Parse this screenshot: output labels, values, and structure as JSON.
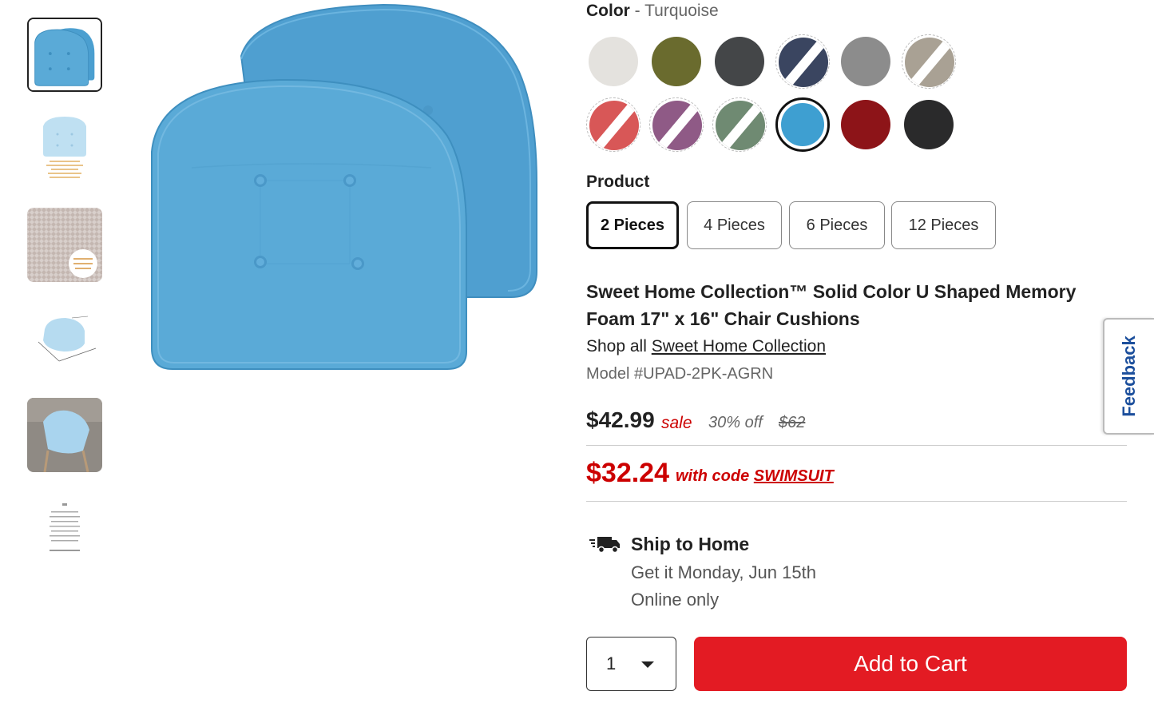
{
  "color_selector": {
    "label": "Color",
    "separator": " - ",
    "selected_value": "Turquoise",
    "swatches": [
      {
        "color": "#e4e2de",
        "available": true,
        "selected": false
      },
      {
        "color": "#6a6b2e",
        "available": true,
        "selected": false
      },
      {
        "color": "#444648",
        "available": true,
        "selected": false
      },
      {
        "color": "#3a4560",
        "available": false,
        "selected": false
      },
      {
        "color": "#8c8c8c",
        "available": true,
        "selected": false
      },
      {
        "color": "#a9a194",
        "available": false,
        "selected": false
      },
      {
        "color": "#d85757",
        "available": false,
        "selected": false
      },
      {
        "color": "#8f5a86",
        "available": false,
        "selected": false
      },
      {
        "color": "#6f8a72",
        "available": false,
        "selected": false
      },
      {
        "color": "#3e9fd1",
        "available": true,
        "selected": true
      },
      {
        "color": "#8d1418",
        "available": true,
        "selected": false
      },
      {
        "color": "#2a2a2b",
        "available": true,
        "selected": false
      }
    ]
  },
  "product_selector": {
    "label": "Product",
    "options": [
      "2 Pieces",
      "4 Pieces",
      "6 Pieces",
      "12 Pieces"
    ],
    "selected": "2 Pieces"
  },
  "product": {
    "title": "Sweet Home Collection™ Solid Color U Shaped Memory Foam 17\" x 16\" Chair Cushions",
    "shop_all_prefix": "Shop all ",
    "brand": "Sweet Home Collection",
    "model": "Model #UPAD-2PK-AGRN"
  },
  "pricing": {
    "sale_price": "$42.99",
    "sale_label": "sale",
    "discount": "30% off",
    "original_price": "$62",
    "promo_price": "$32.24",
    "promo_text": "with code ",
    "promo_code": "SWIMSUIT"
  },
  "shipping": {
    "title": "Ship to Home",
    "date": "Get it Monday, Jun 15th",
    "availability": "Online only"
  },
  "cart": {
    "quantity": "1",
    "add_label": "Add to Cart"
  },
  "feedback_label": "Feedback",
  "colors": {
    "cushion": "#5aaad7",
    "accent_red": "#e31b23",
    "promo_red": "#cc0000",
    "feedback_blue": "#1c4f9c"
  }
}
